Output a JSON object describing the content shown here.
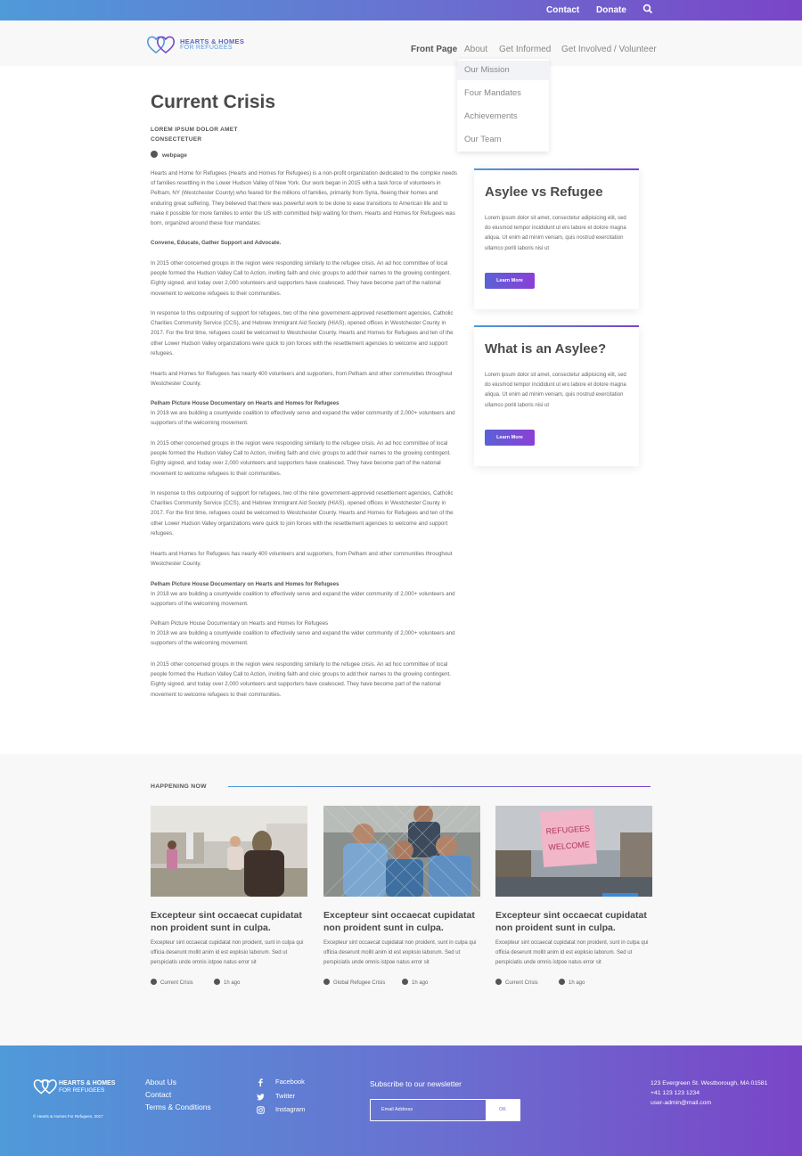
{
  "topbar": {
    "contact": "Contact",
    "donate": "Donate",
    "search_icon": "search-icon"
  },
  "logo": {
    "line1": "HEARTS & HOMES",
    "line2": "FOR REFUGEES"
  },
  "nav": {
    "items": [
      "Front Page",
      "About",
      "Get Informed",
      "Get Involved / Volunteer"
    ],
    "active": "Front Page"
  },
  "dropdown": {
    "items": [
      "Our Mission",
      "Four Mandates",
      "Achievements",
      "Our Team"
    ]
  },
  "article": {
    "title": "Current Crisis",
    "meta1": "LOREM IPSUM DOLOR AMET",
    "meta2": "CONSECTETUER",
    "tag": "webpage",
    "p1": "Hearts and Home for Refugees (Hearts and Homes for Refugees) is a non-profit organization dedicated to the complex needs of families resettling in the Lower Hudson Valley of New York. Our work began in 2015 with a task force of volunteers in Pelham, NY (Westchester County) who feared for the millions of families, primarily from Syria, fleeing their homes and enduring great suffering.  They believed that there was powerful work to be done to ease transitions to American life and to make it possible for more families to enter the US with committed help waiting for them. Hearts and Homes for Refugees was born, organized around these four mandates:",
    "p2": "Convene, Educate, Gather Support and Advocate.",
    "p3": "In 2015 other concerned groups in the region were responding similarly to the refugee crisis. An ad hoc committee of local people formed the Hudson Valley Call to Action, inviting faith and civic groups to add their names to the growing contingent. Eighty signed, and today over 2,000 volunteers and supporters have coalesced. They have become part of the national movement to welcome refugees to their communities.",
    "p4": "In response to this outpouring of support for refugees, two of the nine government-approved resettlement agencies, Catholic Charities Community Service (CCS), and Hebrew Immigrant Aid Society (HIAS), opened offices in Westchester County in 2017.  For the first time, refugees could be welcomed to Westchester County.  Hearts and Homes for Refugees and ten of the other Lower Hudson Valley organizations were quick to join forces with the resettlement agencies to welcome and support refugees.",
    "p5": "Hearts and Homes for Refugees  has nearly 400 volunteers and supporters, from Pelham and other communities throughout Westchester County.",
    "p6_title": "Pelham Picture House Documentary on Hearts and Homes for Refugees",
    "p6": "In 2018 we are building a countywide coalition to effectively serve and expand the wider community of  2,000+ volunteers and supporters of the welcoming movement.",
    "p7": "In 2015 other concerned groups in the region were responding similarly to the refugee crisis. An ad hoc committee of local people formed the Hudson Valley Call to Action, inviting faith and civic groups to add their names to the growing contingent. Eighty signed, and today over 2,000 volunteers and supporters have coalesced. They have become part of the national movement to welcome refugees to their communities.",
    "p8": "In response to this outpouring of support for refugees, two of the nine government-approved resettlement agencies, Catholic Charities Community Service (CCS), and Hebrew Immigrant Aid Society (HIAS), opened offices in Westchester County in 2017.  For the first time, refugees could be welcomed to Westchester County.  Hearts and Homes for Refugees and ten of the other Lower Hudson Valley organizations were quick to join forces with the resettlement agencies to welcome and support refugees.",
    "p9": "Hearts and Homes for Refugees  has nearly 400 volunteers and supporters, from Pelham and other communities throughout Westchester County.",
    "p10_title": "Pelham Picture House Documentary on Hearts and Homes for Refugees",
    "p10": "In 2018 we are building a countywide coalition to effectively serve and expand the wider community of  2,000+ volunteers and supporters of the welcoming movement.",
    "p11_title": "Pelham Picture House Documentary on Hearts and Homes for Refugees",
    "p11": "In 2018 we are building a countywide coalition to effectively serve and expand the wider community of  2,000+ volunteers and supporters of the welcoming movement.",
    "p12": "In 2015 other concerned groups in the region were responding similarly to the refugee crisis. An ad hoc committee of local people formed the Hudson Valley Call to Action, inviting faith and civic groups to add their names to the growing contingent. Eighty signed, and today over 2,000 volunteers and supporters have coalesced. They have become part of the national movement to welcome refugees to their communities."
  },
  "cards": [
    {
      "title": "Asylee vs Refugee",
      "body": "Lorem ipsum dolor sit amet, consectetur adipisicing elit, sed do eiusmod tempor incididunt ut ero labore et dolore magna aliqua. Ut enim ad minim veniam, quis nostrud exercitation ullamco poriti laboris nisi ut",
      "button": "Learn More"
    },
    {
      "title": "What is an Asylee?",
      "body": "Lorem ipsum dolor sit amet, consectetur adipisicing elit, sed do eiusmod tempor incididunt ut ero labore et dolore magna aliqua. Ut enim ad minim veniam, quis nostrud exercitation ullamco poriti laboris nisi ut",
      "button": "Learn More"
    }
  ],
  "happening": {
    "label": "HAPPENING NOW",
    "items": [
      {
        "title": "Excepteur sint occaecat cupidatat non proident sunt in culpa.",
        "body": "Excepteur sint occaecat cupidatat non proident, sunt in culpa qui officia deserunt mollit anim id est eopksio laborum. Sed ut perspiciatis unde omnis istpoe natus error sit",
        "category": "Current Crisis",
        "time": "1h ago"
      },
      {
        "title": "Excepteur sint occaecat cupidatat non proident sunt in culpa.",
        "body": "Excepteur sint occaecat cupidatat non proident, sunt in culpa qui officia deserunt mollit anim id est eopksio laborum. Sed ut perspiciatis unde omnis istpoe natus error sit",
        "category": "Global Refugee Crisis",
        "time": "1h ago"
      },
      {
        "title": "Excepteur sint occaecat cupidatat non proident sunt in culpa.",
        "body": "Excepteur sint occaecat cupidatat non proident, sunt in culpa qui officia deserunt mollit anim id est eopksio laborum. Sed ut perspiciatis unde omnis istpoe natus error sit",
        "category": "Current Crisis",
        "time": "1h ago"
      }
    ],
    "sign_text": "REFUGEES WELCOME"
  },
  "footer": {
    "logo_line1": "HEARTS & HOMES",
    "logo_line2": "FOR REFUGEES",
    "copyright": "© Hearts & Homes For Refugees, 2017",
    "links": [
      "About Us",
      "Contact",
      "Terms & Conditions"
    ],
    "social": [
      "Facebook",
      "Twitter",
      "Instagram"
    ],
    "newsletter_label": "Subscribe to our newsletter",
    "email_placeholder": "Email Address",
    "ok": "OK",
    "address": "123 Evergreen St. Westborough, MA 01581",
    "phone": "+41 123 123 1234",
    "email": "user-admin@mail.com"
  },
  "colors": {
    "accent_start": "#4f9ad9",
    "accent_end": "#7a45c8",
    "title": "#4a4a4a"
  }
}
